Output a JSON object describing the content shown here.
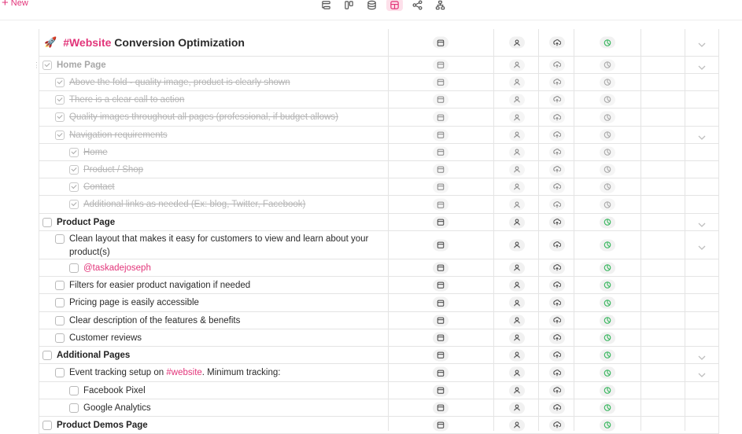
{
  "toolbar": {
    "new_label": "New"
  },
  "colors": {
    "accent": "#e2357a",
    "done_text": "#b5b5b5",
    "progress_green": "#2fb457",
    "border": "#e4e4e4"
  },
  "view_icons": [
    "outline-view-icon",
    "board-view-icon",
    "database-view-icon",
    "table-view-icon",
    "mindmap-view-icon",
    "org-chart-view-icon"
  ],
  "title": {
    "hashtag": "#Website",
    "rest": " Conversion Optimization"
  },
  "rows": [
    {
      "text": "Home Page",
      "checked": true,
      "group": true
    },
    {
      "text": "Above the fold - quality image, product is clearly shown",
      "checked": true
    },
    {
      "text": "There is a clear call to action",
      "checked": true
    },
    {
      "text": "Quality images throughout all pages (professional, if budget allows)",
      "checked": true
    },
    {
      "text": "Navigation requirements",
      "checked": true
    },
    {
      "text": "Home",
      "checked": true
    },
    {
      "text": "Product / Shop",
      "checked": true
    },
    {
      "text": "Contact",
      "checked": true
    },
    {
      "text": "Additional links as needed (Ex: blog, Twitter, Facebook)",
      "checked": true
    },
    {
      "text": "Product Page",
      "checked": false
    },
    {
      "text": "Clean layout that makes it easy for customers to view and learn about your product(s)",
      "checked": false
    },
    {
      "mention": "@taskadejoseph",
      "checked": false
    },
    {
      "text": "Filters for easier product navigation if needed",
      "checked": false
    },
    {
      "text": "Pricing page is easily accessible",
      "checked": false
    },
    {
      "text": "Clear description of the features & benefits",
      "checked": false
    },
    {
      "text": "Customer reviews",
      "checked": false
    },
    {
      "text": "Additional Pages",
      "checked": false
    },
    {
      "text_before": "Event tracking setup on ",
      "hashtag": "#website",
      "text_after": ". Minimum tracking:",
      "checked": false
    },
    {
      "text": "Facebook Pixel",
      "checked": false
    },
    {
      "text": "Google Analytics",
      "checked": false
    },
    {
      "text": "Product Demos Page",
      "checked": false
    }
  ]
}
